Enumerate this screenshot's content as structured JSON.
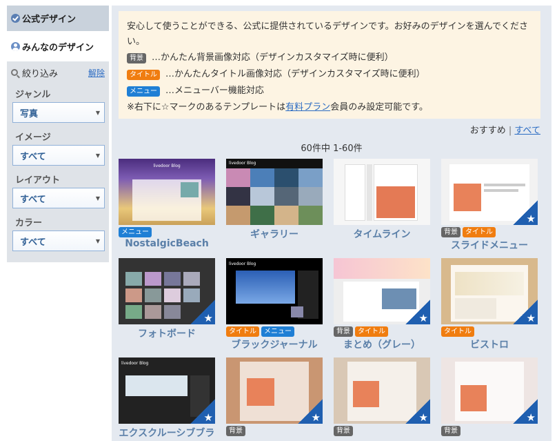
{
  "sidebar": {
    "official_tab": "公式デザイン",
    "community_tab": "みんなのデザイン",
    "filter_label": "絞り込み",
    "reset_label": "解除",
    "filters": [
      {
        "label": "ジャンル",
        "value": "写真"
      },
      {
        "label": "イメージ",
        "value": "すべて"
      },
      {
        "label": "レイアウト",
        "value": "すべて"
      },
      {
        "label": "カラー",
        "value": "すべて"
      }
    ]
  },
  "notice": {
    "intro": "安心して使うことができる、公式に提供されているデザインです。お好みのデザインを選んでください。",
    "lines": [
      {
        "tag": "背景",
        "text": "…かんたん背景画像対応（デザインカスタマイズ時に便利）"
      },
      {
        "tag": "タイトル",
        "text": "…かんたんタイトル画像対応（デザインカスタマイズ時に便利）"
      },
      {
        "tag": "メニュー",
        "text": "…メニューバー機能対応"
      }
    ],
    "note_prefix": "※右下に☆マークのあるテンプレートは",
    "note_link": "有料プラン",
    "note_suffix": "会員のみ設定可能です。"
  },
  "sort": {
    "recommended": "おすすめ",
    "separator": "|",
    "all": "すべて"
  },
  "count_text": "60件中 1-60件",
  "templates": [
    {
      "name": "NostalgicBeach",
      "tags": [
        "メニュー"
      ],
      "premium": false
    },
    {
      "name": "ギャラリー",
      "tags": [],
      "premium": false
    },
    {
      "name": "タイムライン",
      "tags": [],
      "premium": false
    },
    {
      "name": "スライドメニュー",
      "tags": [
        "背景",
        "タイトル"
      ],
      "premium": true
    },
    {
      "name": "フォトボード",
      "tags": [],
      "premium": true
    },
    {
      "name": "ブラックジャーナル",
      "tags": [
        "タイトル",
        "メニュー"
      ],
      "premium": false
    },
    {
      "name": "まとめ（グレー）",
      "tags": [
        "背景",
        "タイトル"
      ],
      "premium": true
    },
    {
      "name": "ビストロ",
      "tags": [
        "タイトル"
      ],
      "premium": true
    },
    {
      "name": "エクスクルーシブブラ",
      "tags": [],
      "premium": true
    },
    {
      "name": "",
      "tags": [
        "背景"
      ],
      "premium": true
    },
    {
      "name": "",
      "tags": [
        "背景"
      ],
      "premium": true
    },
    {
      "name": "",
      "tags": [
        "背景"
      ],
      "premium": true
    }
  ],
  "thumb_texts": {
    "blog_title": "livedoor Blog"
  }
}
